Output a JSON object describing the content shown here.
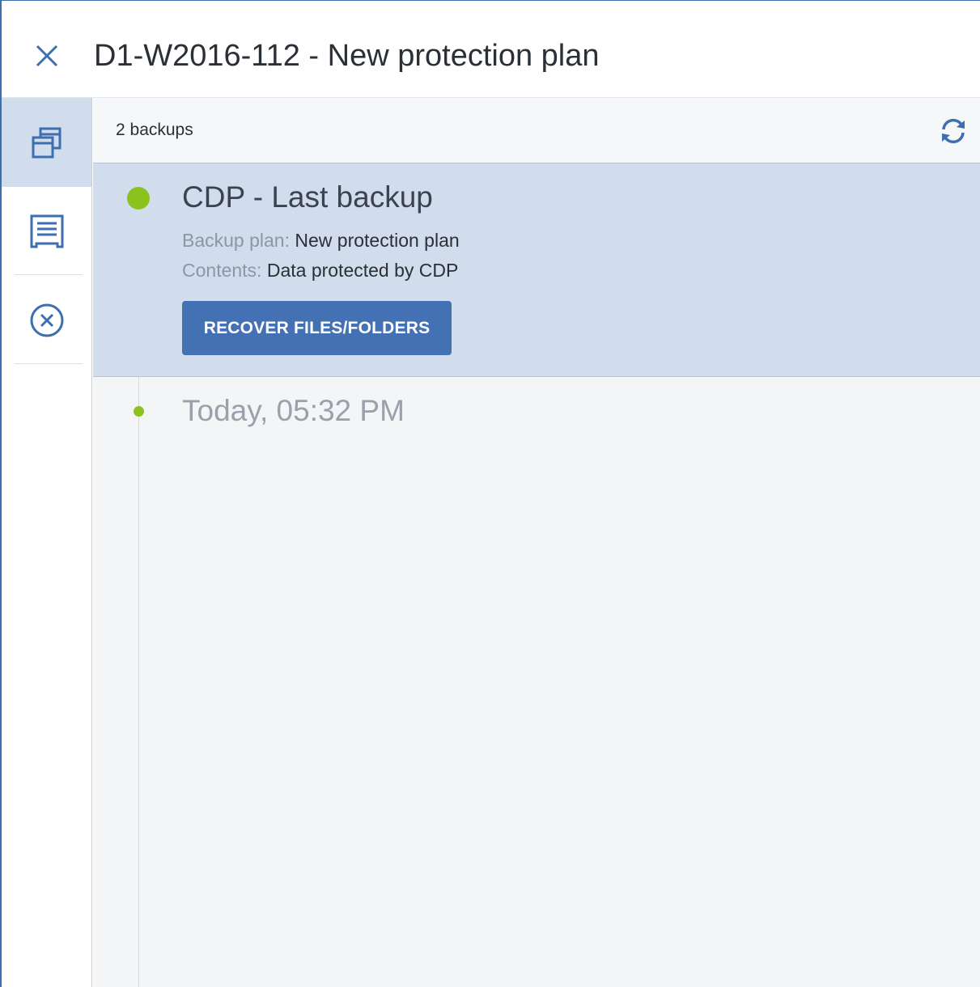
{
  "header": {
    "title": "D1-W2016-112 - New protection plan"
  },
  "sidebar": {
    "items": [
      {
        "name": "backups",
        "icon": "stacked-windows-icon",
        "active": true
      },
      {
        "name": "activities",
        "icon": "document-list-icon",
        "active": false
      },
      {
        "name": "cancel",
        "icon": "circle-x-icon",
        "active": false
      }
    ]
  },
  "main": {
    "backup_count": "2 backups",
    "refresh_icon": "refresh-icon",
    "backups": [
      {
        "title": "CDP - Last backup",
        "backup_plan_label": "Backup plan:",
        "backup_plan_value": "New protection plan",
        "contents_label": "Contents:",
        "contents_value": "Data protected by CDP",
        "action_label": "RECOVER FILES/FOLDERS"
      },
      {
        "title": "Today, 05:32 PM"
      }
    ]
  },
  "colors": {
    "accent": "#4471b3",
    "selected_background": "#d1dcec",
    "status_green": "#8cc21e"
  }
}
